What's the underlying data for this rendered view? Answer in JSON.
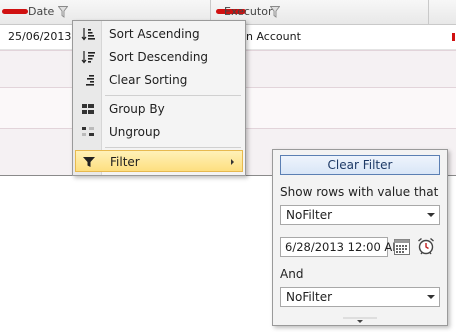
{
  "grid": {
    "columns": [
      {
        "header": "Date"
      },
      {
        "header": "Executor"
      }
    ],
    "row": {
      "date": "25/06/2013 04:",
      "executor": "n Account"
    }
  },
  "menu": {
    "items": [
      {
        "label": "Sort Ascending",
        "icon": "sort-ascending-icon"
      },
      {
        "label": "Sort Descending",
        "icon": "sort-descending-icon"
      },
      {
        "label": "Clear Sorting",
        "icon": "clear-sorting-icon"
      },
      {
        "label": "Group By",
        "icon": "group-by-icon"
      },
      {
        "label": "Ungroup",
        "icon": "ungroup-icon"
      },
      {
        "label": "Filter",
        "icon": "filter-icon"
      }
    ]
  },
  "filter": {
    "clear_label": "Clear Filter",
    "show_rows_label": "Show rows with value that",
    "operator1": "NoFilter",
    "date_value": "6/28/2013 12:00 AM",
    "and_label": "And",
    "operator2": "NoFilter"
  },
  "colors": {
    "accent": "#fddf80",
    "button_border": "#5b7fb3",
    "redaction": "#d01010"
  }
}
